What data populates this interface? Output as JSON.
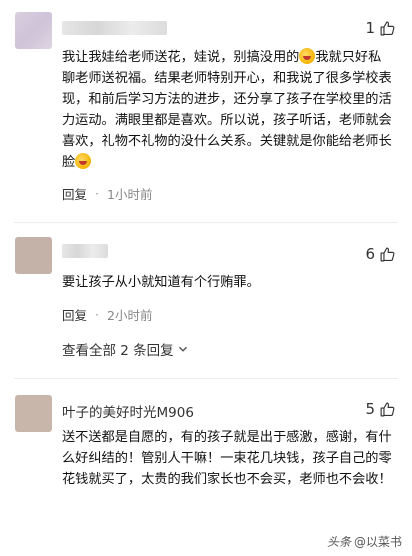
{
  "comments": [
    {
      "username": "",
      "likes": "1",
      "text": "我让我娃给老师送花，娃说，别搞没用的",
      "text_rest": "我就只好私聊老师送祝福。结果老师特别开心，和我说了很多学校表现，和前后学习方法的进步，还分享了孩子在学校里的活力运动。满眼里都是喜欢。所以说，孩子听话，老师就会喜欢，礼物不礼物的没什么关系。关键就是你能给老师长脸",
      "reply_label": "回复",
      "time": "1小时前"
    },
    {
      "username": "",
      "likes": "6",
      "text": "要让孩子从小就知道有个行贿罪。",
      "reply_label": "回复",
      "time": "2小时前",
      "view_all": "查看全部 2 条回复"
    },
    {
      "username": "叶子的美好时光M906",
      "likes": "5",
      "text": "送不送都是自愿的，有的孩子就是出于感激，感谢，有什么好纠结的！管别人干嘛！一束花几块钱，孩子自己的零花钱就买了，太贵的我们家长也不会买，老师也不会收！"
    }
  ],
  "watermark": {
    "prefix": "头条",
    "handle": "@以菜书"
  },
  "icons": {
    "like": "thumbs-up-icon",
    "chevron": "chevron-down-icon"
  }
}
